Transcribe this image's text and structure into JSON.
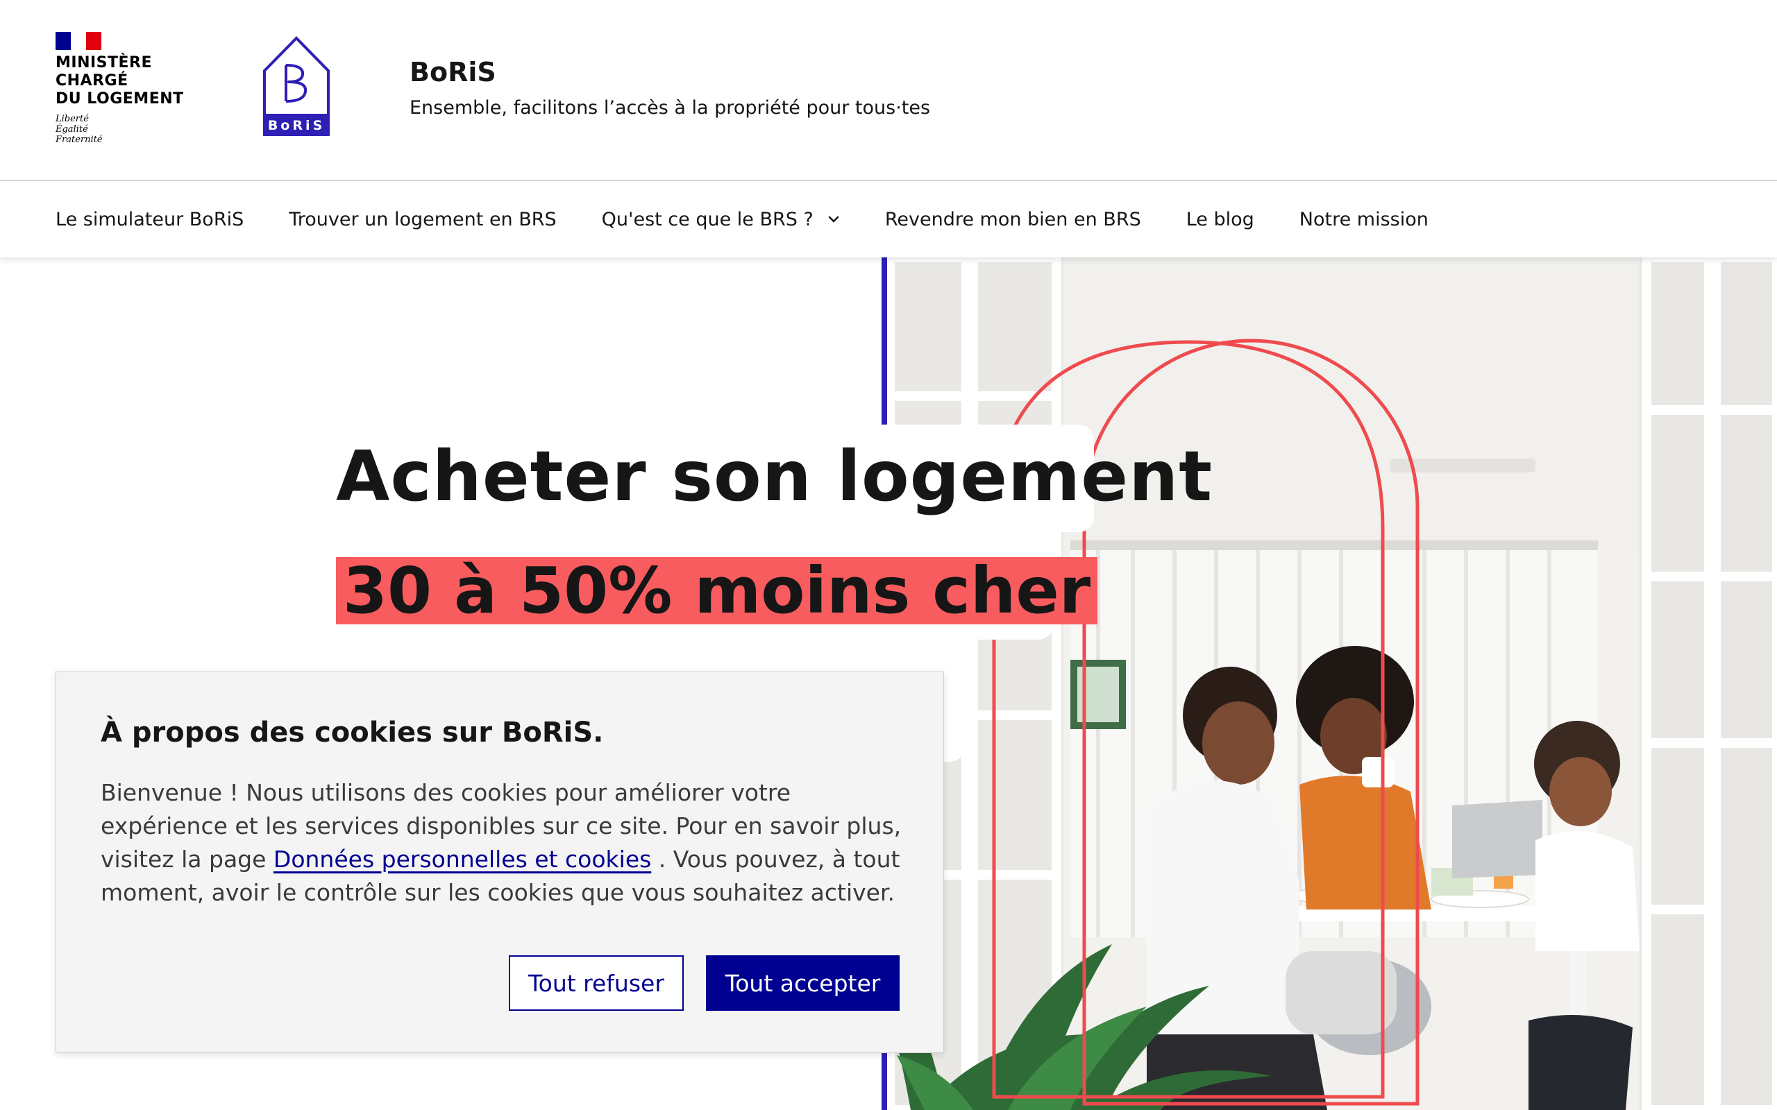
{
  "header": {
    "ministry_lines": [
      "Ministère",
      "chargé",
      "du logement"
    ],
    "motto_lines": [
      "Liberté",
      "Égalité",
      "Fraternité"
    ],
    "logo_text": "BoRiS",
    "title": "BoRiS",
    "tagline": "Ensemble, facilitons l’accès à la propriété pour tous·tes"
  },
  "nav": {
    "items": [
      {
        "label": "Le simulateur BoRiS"
      },
      {
        "label": "Trouver un logement en BRS"
      },
      {
        "label": "Qu'est ce que le BRS ?",
        "icon": "chevron-down-icon"
      },
      {
        "label": "Revendre mon bien en BRS"
      },
      {
        "label": "Le blog"
      },
      {
        "label": "Notre mission"
      }
    ]
  },
  "hero": {
    "title": "Acheter son logement",
    "highlight": "30 à 50% moins cher",
    "image": "family-at-breakfast-table-photo"
  },
  "cookie": {
    "title": "À propos des cookies sur BoRiS.",
    "text_before": "Bienvenue ! Nous utilisons des cookies pour améliorer votre expérience et les services disponibles sur ce site. Pour en savoir plus, visitez la page ",
    "link": "Données personnelles et cookies",
    "text_after": " . Vous pouvez, à tout moment, avoir le contrôle sur les cookies que vous souhaitez activer.",
    "refuse_label": "Tout refuser",
    "accept_label": "Tout accepter"
  },
  "colors": {
    "brand_blue": "#000091",
    "logo_purple": "#2e1fb5",
    "highlight_red": "#f95c5e",
    "arch_red": "#ef4b4f"
  }
}
